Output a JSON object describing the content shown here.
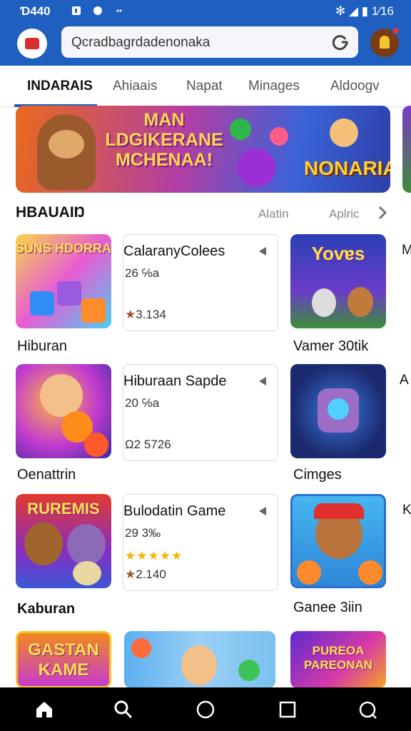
{
  "status_bar": {
    "time": "Ɗ440",
    "right_text": "✻ ◢ ▮ 1⁄16"
  },
  "search": {
    "query": "Qcradbagrdadenonaka"
  },
  "tabs": [
    "INDARAIS",
    "Ahiaais",
    "Napat",
    "Minages",
    "Aldoogv"
  ],
  "banner": {
    "title": "MAN LDGIKERANE MCHENAA!",
    "subtitle": "NONARIA"
  },
  "section": {
    "title": "HBAUAIŊ",
    "link1": "Alatin",
    "link2": "Aplric"
  },
  "rows": [
    {
      "thumb_title": "SUNS HDORRA",
      "caption": "Hiburan",
      "card": {
        "name": "CalaranyColees",
        "meta": "26 ℅a",
        "rating": "3.134",
        "stars": ""
      },
      "right_thumb_title": "Yovɐs",
      "right_caption": "Vamer 30tik",
      "edge": "M"
    },
    {
      "thumb_title": "",
      "caption": "Oenattrin",
      "card": {
        "name": "Hiburaan Sapde",
        "meta": "20 ℅a",
        "rating": "Ω2 5726",
        "stars": ""
      },
      "right_thumb_title": "",
      "right_caption": "Cimges",
      "edge": "A"
    },
    {
      "thumb_title": "RUREMIS",
      "caption": "Kaburan",
      "card": {
        "name": "Bulodatin Game",
        "meta": "29 3‰",
        "rating": "2.140",
        "stars": "★★★★★"
      },
      "right_thumb_title": "",
      "right_caption": "Ganee 3iin",
      "edge": "K"
    }
  ],
  "bottom_row": {
    "thumb1_title": "GASTAN KAME",
    "thumb3_title": "PUREOA PAREONAN"
  },
  "colors": {
    "primary": "#1f5fbf",
    "star": "#f4b400"
  }
}
